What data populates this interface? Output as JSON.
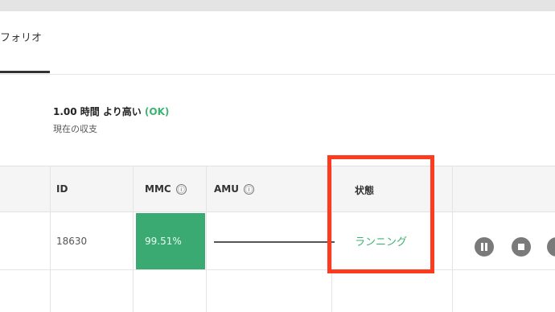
{
  "tabs": {
    "portfolio_label": "フォリオ"
  },
  "summary": {
    "value_text": "1.00 時間 より高い",
    "status_ok": "(OK)",
    "label": "現在の収支"
  },
  "table": {
    "headers": {
      "id": "ID",
      "mmc": "MMC",
      "amu": "AMU",
      "status": "状態"
    },
    "info_glyph": "ⓘ",
    "rows": [
      {
        "id": "18630",
        "mmc": "99.51%",
        "status": "ランニング"
      }
    ]
  },
  "colors": {
    "accent_green": "#3aaa72",
    "status_green": "#3cb371",
    "highlight_red": "#ff3b1f"
  },
  "icons": [
    "info-icon",
    "pause-icon",
    "stop-icon"
  ]
}
